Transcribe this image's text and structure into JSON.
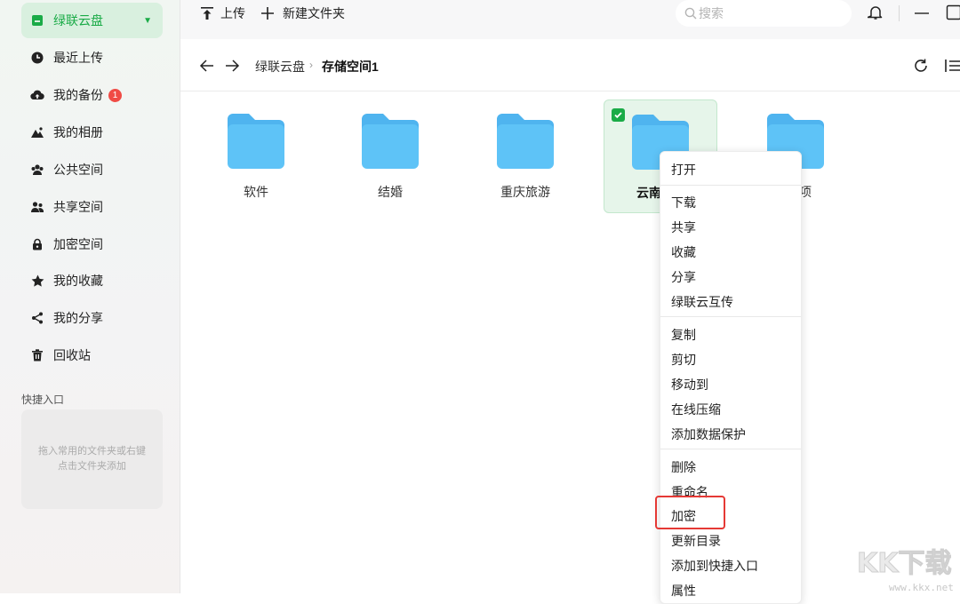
{
  "sidebar": {
    "items": [
      {
        "label": "绿联云盘",
        "icon": "drive-icon",
        "active": true
      },
      {
        "label": "最近上传",
        "icon": "clock-icon"
      },
      {
        "label": "我的备份",
        "icon": "cloud-upload-icon",
        "badge": "1"
      },
      {
        "label": "我的相册",
        "icon": "mountain-icon"
      },
      {
        "label": "公共空间",
        "icon": "group-icon"
      },
      {
        "label": "共享空间",
        "icon": "users-icon"
      },
      {
        "label": "加密空间",
        "icon": "lock-icon"
      },
      {
        "label": "我的收藏",
        "icon": "star-icon"
      },
      {
        "label": "我的分享",
        "icon": "share-icon"
      },
      {
        "label": "回收站",
        "icon": "trash-icon"
      }
    ],
    "quick_title": "快捷入口",
    "quick_placeholder": "拖入常用的文件夹或右键点击文件夹添加"
  },
  "toolbar": {
    "upload": "上传",
    "new_folder": "新建文件夹",
    "search_placeholder": "搜索"
  },
  "breadcrumb": {
    "root": "绿联云盘",
    "current": "存储空间1"
  },
  "folders": [
    {
      "name": "软件"
    },
    {
      "name": "结婚"
    },
    {
      "name": "重庆旅游"
    },
    {
      "name": "云南",
      "selected": true
    },
    {
      "name": "项"
    }
  ],
  "context_menu": {
    "groups": [
      [
        "打开"
      ],
      [
        "下载",
        "共享",
        "收藏",
        "分享",
        "绿联云互传"
      ],
      [
        "复制",
        "剪切",
        "移动到",
        "在线压缩",
        "添加数据保护"
      ],
      [
        "删除",
        "重命名",
        "加密",
        "更新目录",
        "添加到快捷入口",
        "属性"
      ]
    ],
    "highlighted": "加密"
  },
  "watermark": {
    "text": "KK下载",
    "url": "www.kkx.net"
  },
  "colors": {
    "accent": "#1aab47",
    "folder": "#5ec3f7",
    "badge": "#f04b45",
    "highlight": "#e53935"
  }
}
